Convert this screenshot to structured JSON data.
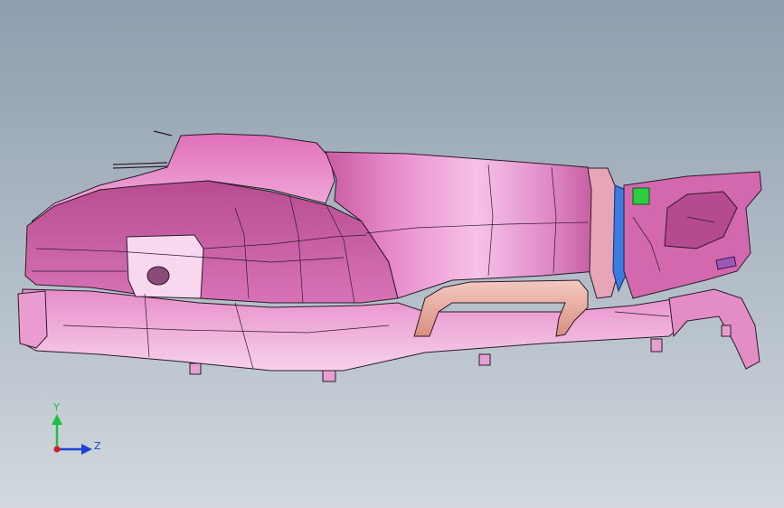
{
  "viewport": {
    "background_top": "#8e9eae",
    "background_bottom": "#d2d8de"
  },
  "model": {
    "name": "",
    "surface_color": "#e080c0",
    "edge_color": "#2a1a2a",
    "accent_colors": {
      "handle": "#e8b0a8",
      "ring_blue": "#3a7be0",
      "bracket_green": "#2ecc40",
      "tab_purple": "#9b59b6"
    }
  },
  "triad": {
    "y_label": "Y",
    "z_label": "Z",
    "y_color": "#1fbf3f",
    "z_color": "#1f3fd6",
    "origin_color": "#d62020"
  }
}
